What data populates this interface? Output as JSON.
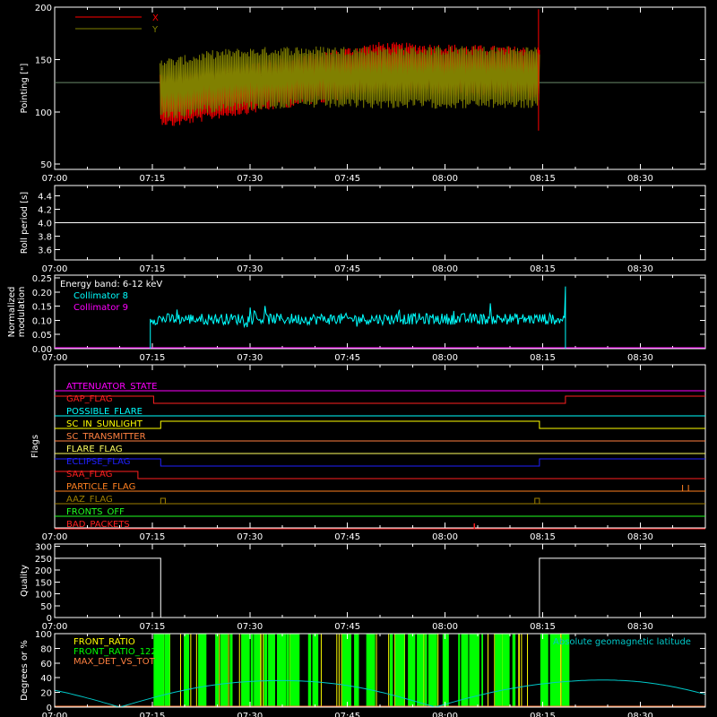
{
  "time_ticks": [
    "07:00",
    "07:15",
    "07:30",
    "07:45",
    "08:00",
    "08:15",
    "08:30"
  ],
  "chart_data": [
    {
      "type": "line",
      "ylabel": "Pointing [\"]",
      "ylim": [
        45,
        200
      ],
      "yticks": [
        "50",
        "100",
        "150",
        "200"
      ],
      "xlim_minutes": [
        0,
        100
      ],
      "series": [
        {
          "name": "X",
          "color": "#ff0000",
          "center": [
            [
              15,
              115
            ],
            [
              18,
              110
            ],
            [
              25,
              118
            ],
            [
              35,
              128
            ],
            [
              45,
              137
            ],
            [
              50,
              142
            ],
            [
              60,
              140
            ],
            [
              75,
              137
            ]
          ],
          "amplitude": 25
        },
        {
          "name": "Y",
          "color": "#808000",
          "center": [
            [
              15,
              125
            ],
            [
              18,
              122
            ],
            [
              25,
              130
            ],
            [
              35,
              133
            ],
            [
              45,
              133
            ],
            [
              60,
              133
            ],
            [
              75,
              133
            ]
          ],
          "amplitude": 30
        }
      ],
      "baseline": {
        "value": 128,
        "color": "#6a8a6a"
      },
      "active_range_minutes": [
        16.2,
        74.5
      ]
    },
    {
      "type": "line",
      "ylabel": "Roll period [s]",
      "ylim": [
        3.45,
        4.55
      ],
      "yticks": [
        "3.6",
        "3.8",
        "4.0",
        "4.2",
        "4.4"
      ],
      "series": [
        {
          "name": "",
          "color": "#ffffff",
          "values": [
            4.0,
            4.0
          ]
        }
      ]
    },
    {
      "type": "line",
      "ylabel": "Normalized modulation",
      "ylim": [
        0,
        0.26
      ],
      "yticks": [
        "0.00",
        "0.05",
        "0.10",
        "0.15",
        "0.20",
        "0.25"
      ],
      "annotation": "Energy band: 6-12 keV",
      "series": [
        {
          "name": "Collimator 8",
          "color": "#00ffff",
          "mean": 0.105,
          "range_minutes": [
            14.7,
            78.5
          ]
        },
        {
          "name": "Collimator 9",
          "color": "#ff00ff",
          "value": 0.0
        }
      ]
    },
    {
      "type": "line",
      "ylabel": "Flags",
      "flags": [
        {
          "name": "ATTENUATOR_STATE",
          "color": "#ff00ff",
          "low": [],
          "high_all": true
        },
        {
          "name": "GAP_FLAG",
          "color": "#ff2020",
          "segments": [
            [
              0,
              15.2,
              1
            ],
            [
              15.2,
              78.5,
              0
            ],
            [
              78.5,
              100,
              1
            ]
          ]
        },
        {
          "name": "POSSIBLE_FLARE",
          "color": "#00ffff",
          "segments": [
            [
              0,
              100,
              0
            ]
          ]
        },
        {
          "name": "SC_IN_SUNLIGHT",
          "color": "#ffff00",
          "segments": [
            [
              0,
              16.3,
              0
            ],
            [
              16.3,
              74.5,
              1
            ],
            [
              74.5,
              100,
              0
            ]
          ]
        },
        {
          "name": "SC_TRANSMITTER",
          "color": "#ff8040",
          "segments": [
            [
              0,
              100,
              0
            ]
          ]
        },
        {
          "name": "FLARE_FLAG",
          "color": "#ffff60",
          "segments": [
            [
              0,
              100,
              0
            ]
          ]
        },
        {
          "name": "ECLIPSE_FLAG",
          "color": "#2020ff",
          "segments": [
            [
              0,
              16.3,
              1
            ],
            [
              16.3,
              74.5,
              0
            ],
            [
              74.5,
              100,
              1
            ]
          ]
        },
        {
          "name": "SAA_FLAG",
          "color": "#ff2020",
          "segments": [
            [
              0,
              12.8,
              1
            ],
            [
              12.8,
              100,
              0
            ]
          ]
        },
        {
          "name": "PARTICLE_FLAG",
          "color": "#ff8020",
          "segments": [
            [
              0,
              100,
              0
            ]
          ]
        },
        {
          "name": "AAZ_FLAG",
          "color": "#a08000",
          "segments": [
            [
              0,
              100,
              0
            ]
          ]
        },
        {
          "name": "FRONTS_OFF",
          "color": "#20ff20",
          "segments": [
            [
              0,
              100,
              0
            ]
          ]
        },
        {
          "name": "BAD_PACKETS",
          "color": "#ff2020",
          "segments": [
            [
              0,
              100,
              0
            ]
          ]
        }
      ]
    },
    {
      "type": "line",
      "ylabel": "Quality",
      "ylim": [
        0,
        310
      ],
      "yticks": [
        "0",
        "50",
        "100",
        "150",
        "200",
        "250",
        "300"
      ],
      "series": [
        {
          "name": "",
          "color": "#ffffff",
          "segments": [
            [
              0,
              16.3,
              250
            ],
            [
              16.3,
              74.5,
              0
            ],
            [
              74.5,
              100,
              250
            ]
          ]
        }
      ]
    },
    {
      "type": "line",
      "ylabel": "Degrees or %",
      "ylim": [
        0,
        100
      ],
      "yticks": [
        "0",
        "20",
        "40",
        "60",
        "80",
        "100"
      ],
      "series": [
        {
          "name": "FRONT_RATIO",
          "color": "#ffff00"
        },
        {
          "name": "FRONT_RATIO_122",
          "color": "#00ff00"
        },
        {
          "name": "MAX_DET_VS_TOT",
          "color": "#ff8040"
        },
        {
          "name": "Absolute geomagnetic latitude",
          "color": "#00c8c8"
        }
      ]
    }
  ]
}
